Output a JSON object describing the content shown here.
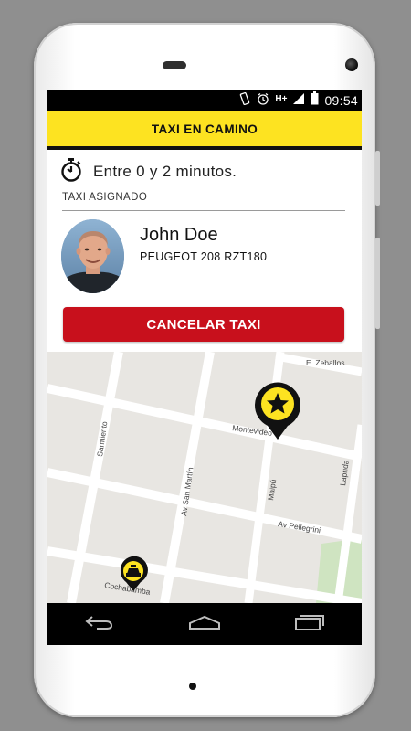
{
  "status_bar": {
    "network": "H+",
    "time": "09:54"
  },
  "header": {
    "title": "TAXI EN CAMINO"
  },
  "eta": {
    "icon": "stopwatch-icon",
    "text": "Entre 0 y 2 minutos."
  },
  "section": {
    "label": "TAXI ASIGNADO"
  },
  "driver": {
    "name": "John Doe",
    "car": "PEUGEOT 208 RZT180"
  },
  "actions": {
    "cancel_label": "CANCELAR TAXI"
  },
  "map": {
    "streets": {
      "zeballos": "E. Zeballos",
      "montevideo": "Montevideo",
      "sarmiento": "Sarmiento",
      "san_martin": "Av San Martín",
      "maipu": "Maipú",
      "laprida": "Laprida",
      "pellegrini": "Av Pellegrini",
      "cochabamba": "Cochabamba"
    },
    "marker_destination_icon": "star-icon",
    "marker_taxi_icon": "taxi-icon"
  },
  "colors": {
    "accent": "#fde321",
    "cancel": "#c8101c"
  }
}
